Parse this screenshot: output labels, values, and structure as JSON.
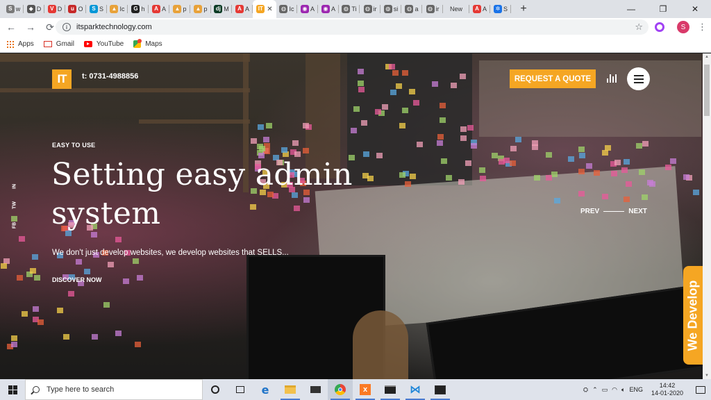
{
  "browser": {
    "tabs": [
      {
        "icon": "s-grey-icon",
        "letter": "S",
        "color": "#7a7a7a",
        "label": "w"
      },
      {
        "icon": "diamond-icon",
        "letter": "◆",
        "color": "#555555",
        "label": "D"
      },
      {
        "icon": "v-red-icon",
        "letter": "V",
        "color": "#e53935",
        "label": "D"
      },
      {
        "icon": "udemy-icon",
        "letter": "u",
        "color": "#c62828",
        "label": "O"
      },
      {
        "icon": "skype-icon",
        "letter": "S",
        "color": "#0097d7",
        "label": "S"
      },
      {
        "icon": "chart-icon",
        "letter": "▲",
        "color": "#e8a23a",
        "label": "Ic"
      },
      {
        "icon": "github-icon",
        "letter": "G",
        "color": "#222222",
        "label": "h"
      },
      {
        "icon": "adobe-icon",
        "letter": "A",
        "color": "#e53935",
        "label": "A"
      },
      {
        "icon": "chart-icon",
        "letter": "▲",
        "color": "#e8a23a",
        "label": "p"
      },
      {
        "icon": "chart-icon",
        "letter": "▲",
        "color": "#e8a23a",
        "label": "p"
      },
      {
        "icon": "django-icon",
        "letter": "dj",
        "color": "#0c3c26",
        "label": "M"
      },
      {
        "icon": "adobe-icon",
        "letter": "A",
        "color": "#e53935",
        "label": "A"
      },
      {
        "icon": "it-logo-icon",
        "letter": "IT",
        "color": "#f5a623",
        "label": "",
        "active": true,
        "close": "✕"
      },
      {
        "icon": "globe-icon",
        "letter": "◍",
        "color": "#666666",
        "label": "Ic"
      },
      {
        "icon": "chrome-icon",
        "letter": "◉",
        "color": "#9c27b0",
        "label": "A"
      },
      {
        "icon": "chrome-icon",
        "letter": "◉",
        "color": "#9c27b0",
        "label": "A"
      },
      {
        "icon": "globe-icon",
        "letter": "◍",
        "color": "#666666",
        "label": "Ti"
      },
      {
        "icon": "globe-icon",
        "letter": "◍",
        "color": "#666666",
        "label": "ir"
      },
      {
        "icon": "globe-icon",
        "letter": "◍",
        "color": "#666666",
        "label": "si"
      },
      {
        "icon": "globe-icon",
        "letter": "◍",
        "color": "#666666",
        "label": "a"
      },
      {
        "icon": "globe-icon",
        "letter": "◍",
        "color": "#666666",
        "label": "ir"
      },
      {
        "icon": "none",
        "letter": "",
        "color": "#ffffff",
        "label": "New"
      },
      {
        "icon": "adobe-icon",
        "letter": "A",
        "color": "#e53935",
        "label": "A"
      },
      {
        "icon": "gear-icon",
        "letter": "✲",
        "color": "#1a73e8",
        "label": "S"
      }
    ],
    "new_tab": "+",
    "minimize": "—",
    "restore": "❐",
    "close": "✕",
    "back": "←",
    "forward": "→",
    "reload": "⟳",
    "info": "i",
    "url": "itsparktechnology.com",
    "star": "☆",
    "profile_letter": "S",
    "menu": "⋮",
    "bookmarks": [
      {
        "label": "Apps"
      },
      {
        "label": "Gmail"
      },
      {
        "label": "YouTube"
      },
      {
        "label": "Maps"
      }
    ]
  },
  "site": {
    "logo_text": "IT",
    "phone": "t: 0731-4988856",
    "quote_button": "REQUEST A QUOTE",
    "social": [
      "IN",
      "TW",
      "FB"
    ],
    "eyebrow": "EASY TO USE",
    "headline": "Setting easy admin system",
    "subtext": "We don't just develop websites, we develop websites that SELLS...",
    "cta": "DISCOVER NOW",
    "prev": "PREV",
    "next": "NEXT",
    "side_tab": "We Develop",
    "accent_color": "#f5a623"
  },
  "taskbar": {
    "search_placeholder": "Type here to search",
    "tray_language": "ENG",
    "time": "14:42",
    "date": "14-01-2020"
  }
}
